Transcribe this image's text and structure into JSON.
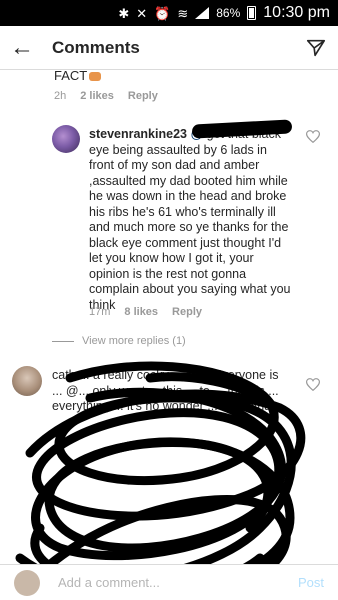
{
  "status_bar": {
    "battery": "86%",
    "time": "10:30 pm"
  },
  "header": {
    "title": "Comments"
  },
  "previous_comment": {
    "text_tail": "FACT",
    "time": "2h",
    "likes": "2 likes",
    "reply_label": "Reply"
  },
  "comment1": {
    "username": "stevenrankine23",
    "mention": "@",
    "body": "got that black eye being assaulted by 6 lads in front of my son dad and amber ,assaulted my dad booted him while he was down in the head and broke his ribs he's 61 who's terminally ill and much more so ye thanks for the black eye comment just thought I'd let you know how I got it, your opinion is the rest not gonna complain about you saying what you think",
    "time": "17m",
    "likes": "8 likes",
    "reply_label": "Reply"
  },
  "view_replies": "View more replies (1)",
  "comment2": {
    "visible_text": "cath ... a really cocky ... tion. Everyone is ... @... only want ... this ... to ... friends ... everything ... it's no wonder ... s love/hate"
  },
  "input": {
    "placeholder": "Add a comment...",
    "post_label": "Post"
  },
  "colors": {
    "link": "#003569",
    "meta": "#999999",
    "post_disabled": "#b2dffc"
  }
}
